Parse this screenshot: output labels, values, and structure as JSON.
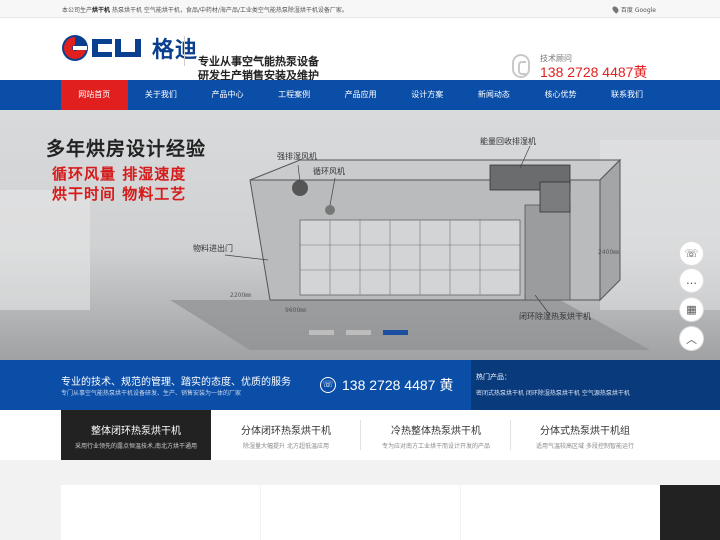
{
  "topbar": {
    "intro_prefix": "本公司生产",
    "intro_bold": "烘干机",
    "intro_rest": " 热泵烘干机  空气能烘干机，食品/中药材/海产品/工业类空气能热泵除湿烘干机设备厂家。",
    "search_text": "百度 Google"
  },
  "header": {
    "logo_text": "格迪",
    "slogan_line1": "专业从事空气能热泵设备",
    "slogan_line2": "研发生产销售安装及维护",
    "hotline_label": "技术顾问",
    "hotline_number": "138 2728 4487黄"
  },
  "nav": {
    "items": [
      {
        "label": "网站首页",
        "active": true
      },
      {
        "label": "关于我们"
      },
      {
        "label": "产品中心"
      },
      {
        "label": "工程案例"
      },
      {
        "label": "产品应用"
      },
      {
        "label": "设计方案"
      },
      {
        "label": "新闻动态"
      },
      {
        "label": "核心优势"
      },
      {
        "label": "联系我们"
      }
    ]
  },
  "banner": {
    "headline": "多年烘房设计经验",
    "red_line1": "循环风量 排湿速度",
    "red_line2": "烘干时间 物料工艺",
    "labels": {
      "energy_recovery": "能量回收排湿机",
      "exhaust_fan": "强排湿风机",
      "circulation_fan": "循环风机",
      "material_door": "物料进出门",
      "closed_dryer": "闭环除湿热泵烘干机",
      "dim_2400": "2400㎜",
      "dim_2200": "2200㎜",
      "dim_9600": "9600㎜"
    },
    "slides": 3,
    "active_slide": 3
  },
  "float_buttons": {
    "phone_icon": "☏",
    "chat_icon": "…",
    "qr_icon": "▦",
    "top_icon": "︿"
  },
  "info": {
    "title": "专业的技术、规范的管理、踏实的态度、优质的服务",
    "subtitle": "专门从事空气能热泵烘干机设备研发、生产、销售安装为一体的厂家",
    "tel": "138 2728 4487 黄",
    "hot_label": "热门产品：",
    "hot_links": "密闭式热泵烘干机  闭环除湿热泵烘干机  空气源热泵烘干机"
  },
  "categories": [
    {
      "title": "整体闭环热泵烘干机",
      "desc": "采用行业领先的露点恒温技术,南北方烘干通用",
      "active": true
    },
    {
      "title": "分体闭环热泵烘干机",
      "desc": "除湿量大幅提升 北方超低温应用"
    },
    {
      "title": "冷热整体热泵烘干机",
      "desc": "专为应对南方工业烘干而设计开发的产品"
    },
    {
      "title": "分体式热泵烘干机组",
      "desc": "适用气温较高区域 多段控制智能运行"
    }
  ],
  "colors": {
    "brand_blue": "#0a4ea8",
    "accent_red": "#e21f1f"
  }
}
